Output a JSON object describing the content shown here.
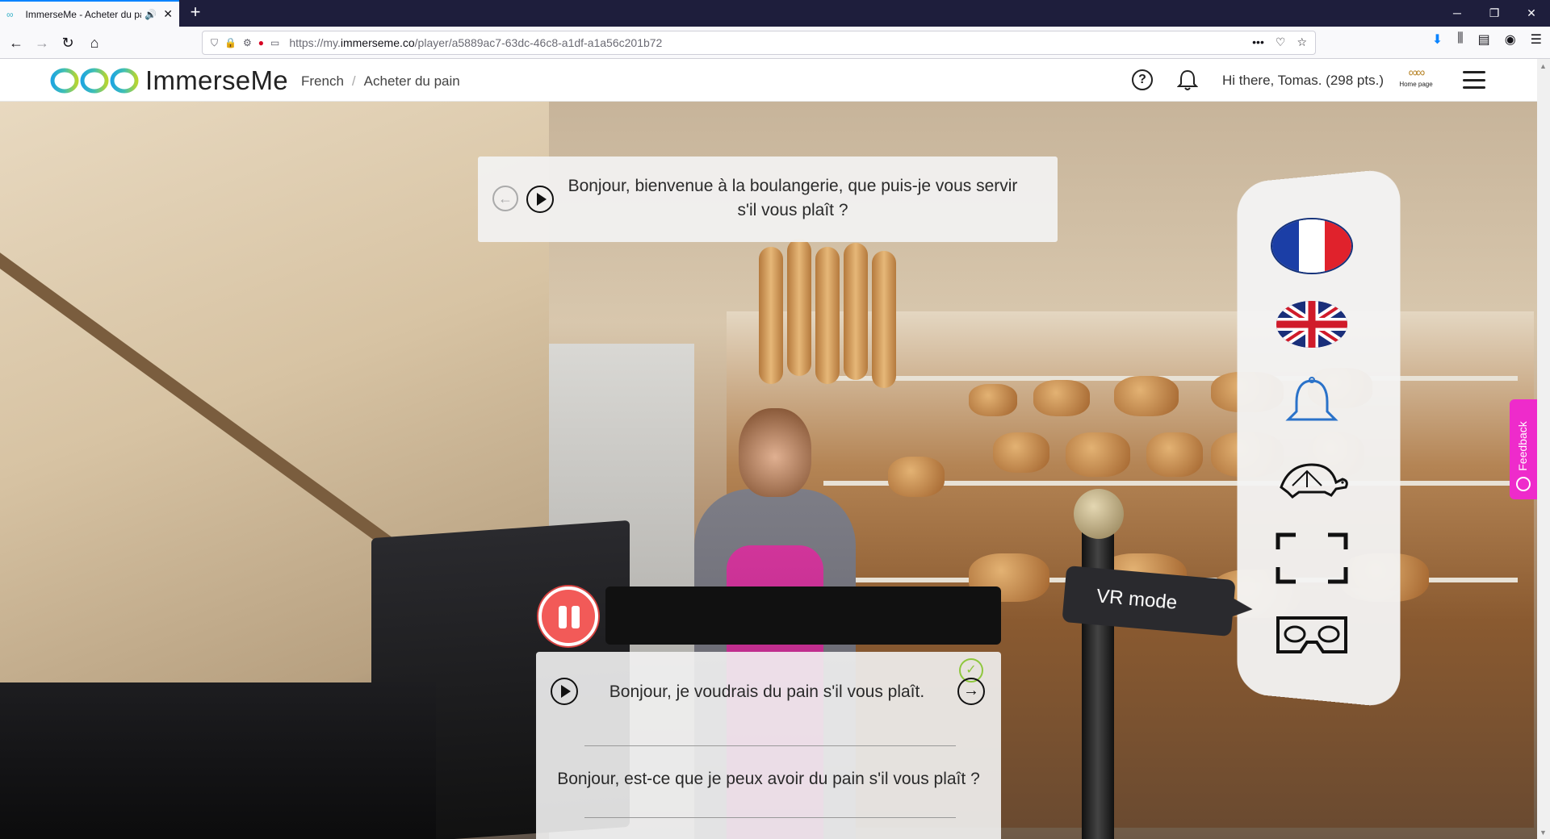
{
  "browser": {
    "tab_title": "ImmerseMe - Acheter du pa",
    "url_prefix": "https://my.",
    "url_domain": "immerseme.co",
    "url_path": "/player/a5889ac7-63dc-46c8-a1df-a1a56c201b72"
  },
  "header": {
    "brand": "ImmerseMe",
    "breadcrumb": [
      "French",
      "Acheter du pain"
    ],
    "greeting": "Hi there, Tomas. (298 pts.)",
    "home_label": "Home page"
  },
  "npc": {
    "text": "Bonjour, bienvenue à la boulangerie, que puis-je vous servir s'il vous plaît ?"
  },
  "responses": [
    "Bonjour, je voudrais du pain s'il vous plaît.",
    "Bonjour, est-ce que je peux avoir du pain s'il vous plaît ?"
  ],
  "tools": {
    "vr_tooltip": "VR mode"
  },
  "feedback": {
    "label": "Feedback"
  },
  "colors": {
    "brand_pink": "#ee2bcb",
    "record_red": "#f25a58",
    "check_green": "#8fc73e"
  }
}
